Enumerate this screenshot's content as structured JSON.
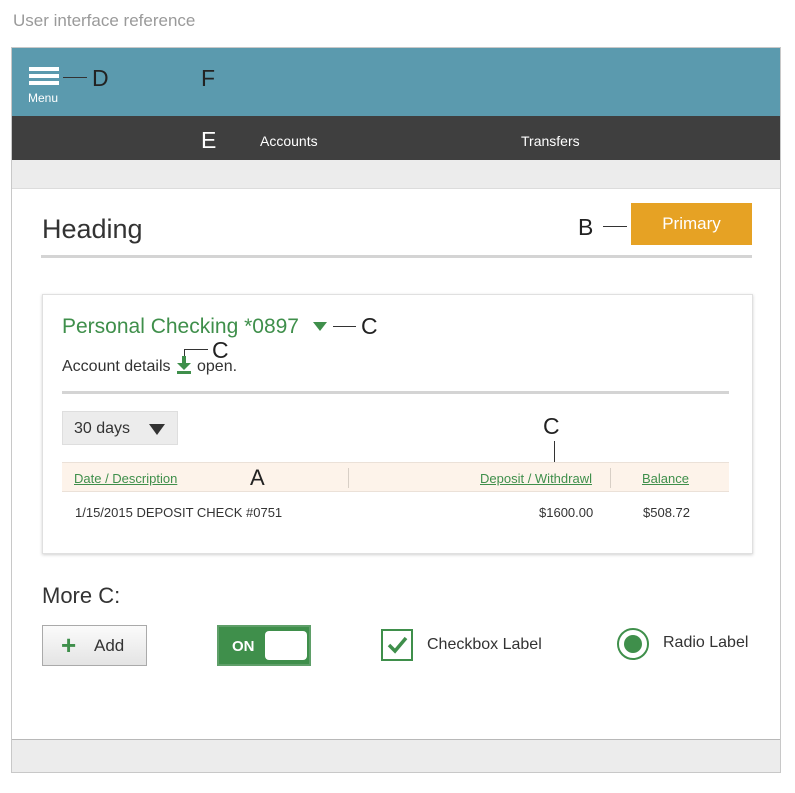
{
  "caption": "User interface reference",
  "topbar": {
    "menu_label": "Menu",
    "menu_icon": "hamburger-icon"
  },
  "nav": {
    "items": [
      {
        "label": "Accounts"
      },
      {
        "label": "Transfers"
      }
    ]
  },
  "annotations": {
    "d": "D",
    "f": "F",
    "e": "E",
    "b": "B",
    "c1": "C",
    "c2": "C",
    "c3": "C",
    "a": "A"
  },
  "page": {
    "heading": "Heading",
    "primary_label": "Primary"
  },
  "account": {
    "title": "Personal Checking *0897",
    "details_prefix": "Account details",
    "details_suffix": "open.",
    "download_icon": "download-icon"
  },
  "filter": {
    "selected": "30 days"
  },
  "table": {
    "headers": {
      "date": "Date / Description",
      "amount": "Deposit / Withdrawl",
      "balance": "Balance"
    },
    "rows": [
      {
        "description": "1/15/2015 DEPOSIT CHECK #0751",
        "amount": "$1600.00",
        "balance": "$508.72"
      }
    ]
  },
  "more": {
    "heading": "More C:",
    "add_label": "Add",
    "toggle_label": "ON",
    "checkbox_label": "Checkbox Label",
    "radio_label": "Radio Label"
  },
  "colors": {
    "topbar": "#5b9aae",
    "navbar": "#3f3f3f",
    "primary": "#e6a224",
    "accent_green": "#3f8f4b",
    "table_header": "#fdf3ea"
  }
}
